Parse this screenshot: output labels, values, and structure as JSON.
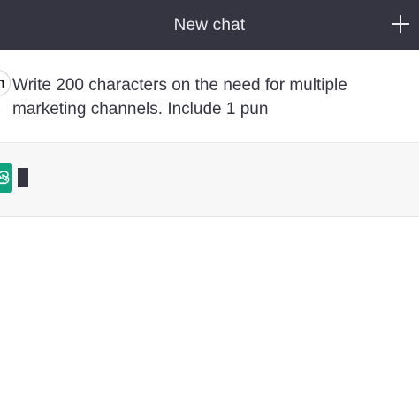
{
  "header": {
    "title": "New chat",
    "plus_icon": "plus-icon"
  },
  "conversation": {
    "user_message": {
      "avatar_letter": "n",
      "text": "Write 200 characters on the need for multiple marketing channels. Include 1 pun"
    },
    "assistant_message": {
      "avatar_icon": "openai-logo-icon",
      "state": "typing-cursor"
    }
  },
  "colors": {
    "header_bg": "#343541",
    "header_text": "#ececf1",
    "assistant_bg": "#f7f7f8",
    "assistant_avatar": "#10a37f",
    "text": "#343541"
  }
}
